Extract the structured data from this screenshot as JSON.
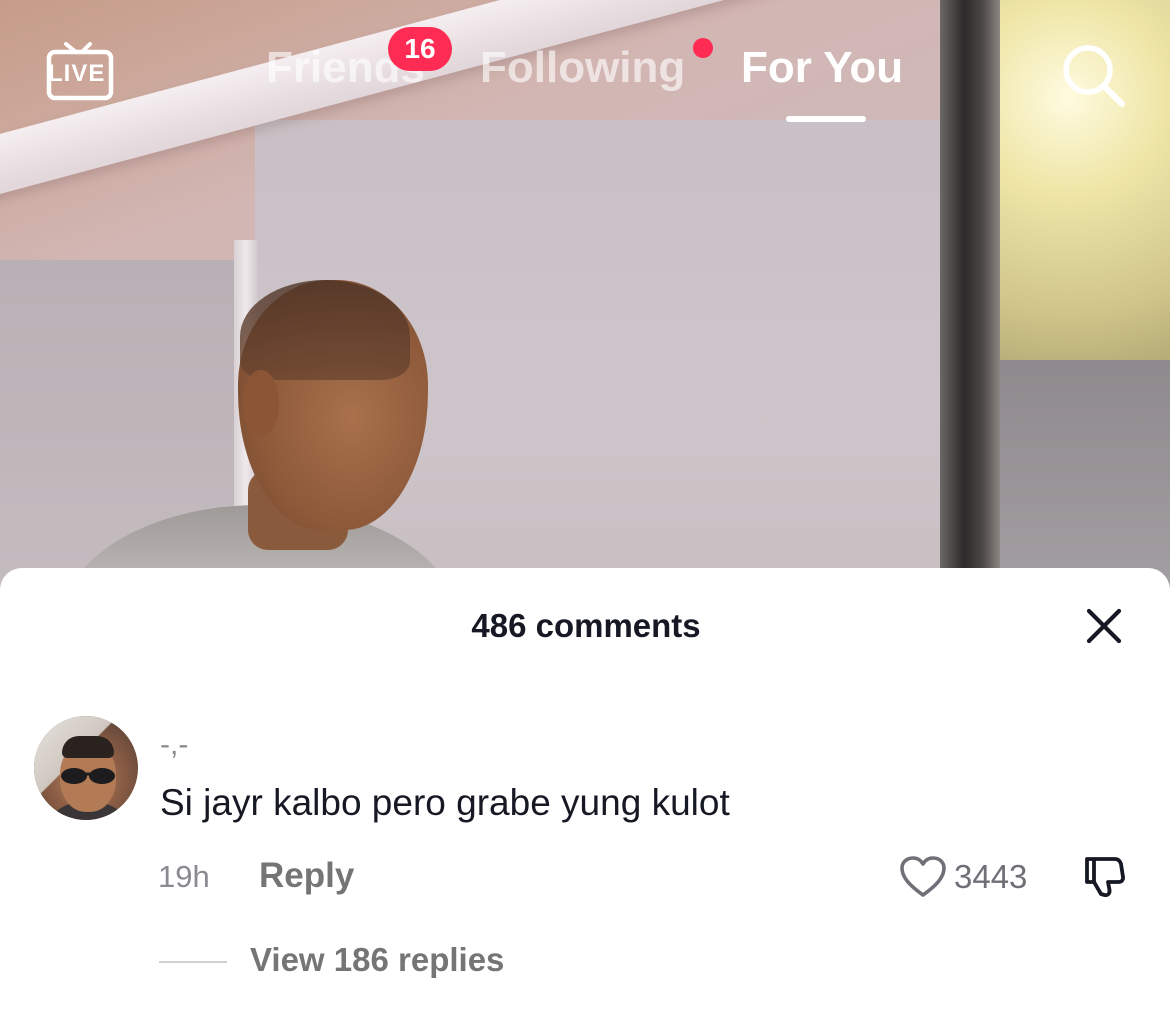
{
  "top_nav": {
    "live_label": "LIVE",
    "tabs": [
      {
        "label": "Friends",
        "badge": "16"
      },
      {
        "label": "Following",
        "has_dot": true
      },
      {
        "label": "For You",
        "active": true
      }
    ],
    "accent_color": "#fe2c55"
  },
  "comments_sheet": {
    "title": "486 comments",
    "comment": {
      "username": "-,-",
      "text": "Si jayr kalbo pero grabe yung kulot",
      "time": "19h",
      "reply_label": "Reply",
      "likes": "3443",
      "view_replies_label": "View 186 replies"
    }
  },
  "icons": [
    "live-tv-icon",
    "search-icon",
    "close-icon",
    "heart-icon",
    "dislike-icon"
  ]
}
